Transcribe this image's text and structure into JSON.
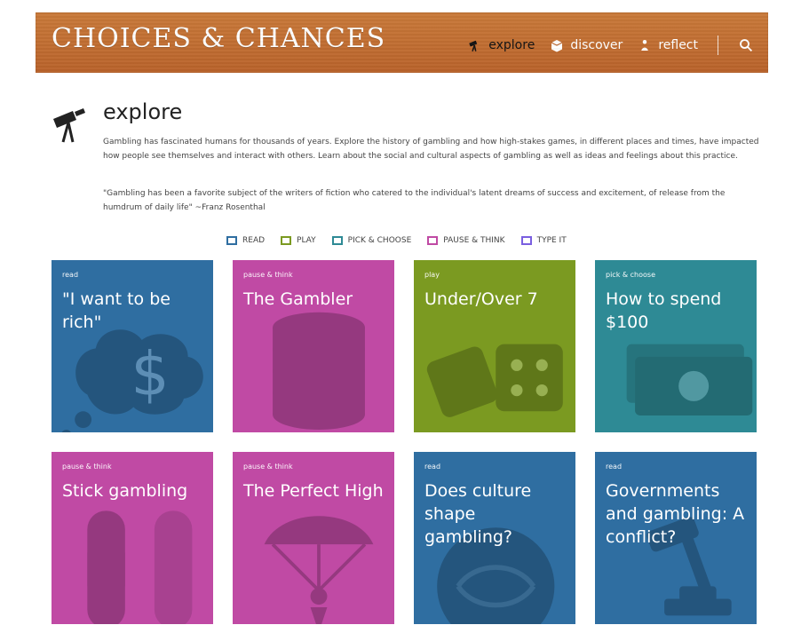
{
  "header": {
    "logo": "CHOICES & CHANCES",
    "nav": [
      {
        "label": "explore",
        "icon": "telescope-icon"
      },
      {
        "label": "discover",
        "icon": "box-icon"
      },
      {
        "label": "reflect",
        "icon": "thinker-icon"
      }
    ],
    "search_icon": "search-icon"
  },
  "intro": {
    "title": "explore",
    "paragraph_1": "Gambling has fascinated humans for thousands of years. Explore the history of gambling and how high-stakes games, in different places and times, have impacted how people see themselves and interact with others. Learn about the social and cultural aspects of gambling as well as ideas and feelings about this practice.",
    "quote": "\"Gambling has been a favorite subject of the writers of fiction who catered to the individual's latent dreams of success and excitement, of release from the humdrum of daily life\" ~Franz Rosenthal"
  },
  "legend": [
    {
      "label": "READ",
      "color": "#2f6ea1"
    },
    {
      "label": "PLAY",
      "color": "#7b9a21"
    },
    {
      "label": "PICK & CHOOSE",
      "color": "#2e8a95"
    },
    {
      "label": "PAUSE & THINK",
      "color": "#c04aa4"
    },
    {
      "label": "TYPE IT",
      "color": "#7a5fe0"
    }
  ],
  "tiles": [
    {
      "type": "read",
      "title": "\"I want to be rich\"",
      "color": "#2f6ea1",
      "icon": "money-thought-icon"
    },
    {
      "type": "pause & think",
      "title": "The Gambler",
      "color": "#c04aa4",
      "icon": "chips-stack-icon"
    },
    {
      "type": "play",
      "title": "Under/Over 7",
      "color": "#7b9a21",
      "icon": "dice-icon"
    },
    {
      "type": "pick & choose",
      "title": "How to spend $100",
      "color": "#2e8a95",
      "icon": "cash-icon"
    },
    {
      "type": "pause & think",
      "title": "Stick gambling",
      "color": "#c04aa4",
      "icon": "sticks-icon"
    },
    {
      "type": "pause & think",
      "title": "The Perfect High",
      "color": "#c04aa4",
      "icon": "parachute-icon"
    },
    {
      "type": "read",
      "title": "Does culture shape gambling?",
      "color": "#2f6ea1",
      "icon": "globe-icon"
    },
    {
      "type": "read",
      "title": "Governments and gambling: A conflict?",
      "color": "#2f6ea1",
      "icon": "gavel-icon"
    }
  ]
}
